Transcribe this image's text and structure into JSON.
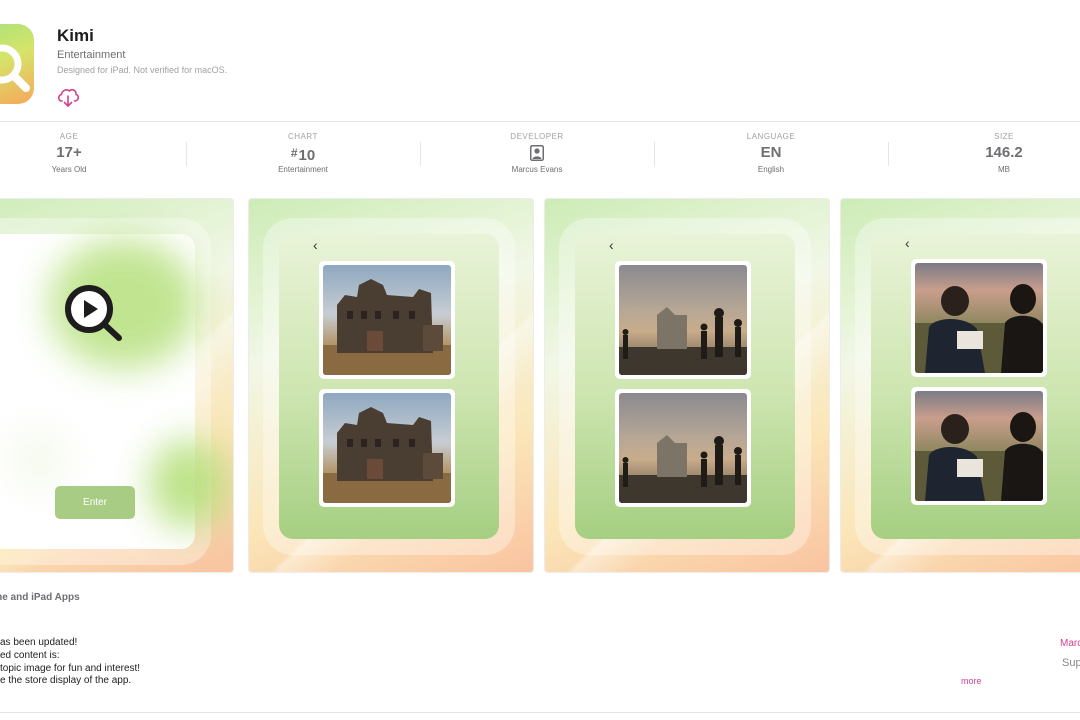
{
  "app": {
    "name": "Kimi",
    "category": "Entertainment",
    "note": "Designed for iPad. Not verified for macOS."
  },
  "info": [
    {
      "label": "AGE",
      "value": "17+",
      "sub": "Years Old"
    },
    {
      "label": "CHART",
      "value": "10",
      "prefix": "#",
      "sub": "Entertainment"
    },
    {
      "label": "DEVELOPER",
      "value": "",
      "sub": "Marcus Evans"
    },
    {
      "label": "LANGUAGE",
      "value": "EN",
      "sub": "English"
    },
    {
      "label": "SIZE",
      "value": "146.2",
      "sub": "MB"
    }
  ],
  "screenshots": {
    "enter_label": "Enter",
    "back_glyph": "‹"
  },
  "section": {
    "title": "one and iPad Apps"
  },
  "release_notes": {
    "line1": "as been updated!",
    "line2": "ed content is:",
    "line3": "topic image for fun and interest!",
    "line4": "e the store display of the app.",
    "more": "more",
    "date": "Marc",
    "support": "Sup"
  },
  "colors": {
    "accent": "#d63f8c",
    "enter_button": "#a9cc84",
    "icon_gradient_start": "#a6e27a",
    "icon_gradient_end": "#f5a85a"
  },
  "icons": {
    "app_icon": "magnifier-play-icon",
    "download": "cloud-download-icon",
    "developer": "person-icon",
    "back": "chevron-left-icon"
  }
}
